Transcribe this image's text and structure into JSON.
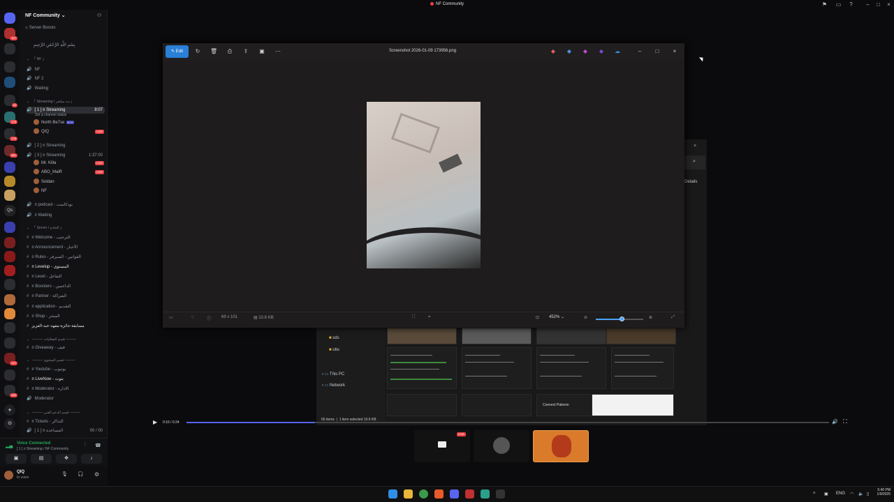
{
  "window": {
    "title": "NF Community"
  },
  "server": {
    "name": "NF Community",
    "boosts": "Server Boosts",
    "intro": "بِسْمِ اللَّهِ الرَّحْمَٰنِ الرَّحِيمِ"
  },
  "rail_badges": [
    "307",
    "178",
    "42",
    "176",
    "561",
    "217",
    "Qs",
    "460"
  ],
  "channels": [
    {
      "label": "「 NF 」",
      "type": "cat"
    },
    {
      "label": "NF",
      "type": "voice"
    },
    {
      "label": "NF 2",
      "type": "voice"
    },
    {
      "label": "Waiting",
      "type": "voice"
    },
    {
      "label": "「 Streaming / بث مباشر 」",
      "type": "cat"
    },
    {
      "label": "[ 1 ] ¤ Streaming",
      "type": "voice",
      "selected": true,
      "right": "8:07"
    },
    {
      "label": "Set a channel status",
      "type": "sub"
    },
    {
      "label": "[ 2 ] ¤ Streaming",
      "type": "voice"
    },
    {
      "label": "[ 3 ] ¤ Streaming",
      "type": "voice",
      "right": "1:37:00"
    },
    {
      "label": "¤ podcast - بودكاست",
      "type": "voice"
    },
    {
      "label": "¤ Waiting",
      "type": "voice"
    },
    {
      "label": "「 Server / الخادم 」",
      "type": "cat"
    },
    {
      "label": "¤ Welcome - الترحيب",
      "type": "text"
    },
    {
      "label": "¤ Announcement - الأخبار",
      "type": "text"
    },
    {
      "label": "¤ Rules - القوانين - السيرفر",
      "type": "text"
    },
    {
      "label": "¤ Levelup - المستوى",
      "type": "text",
      "bright": true
    },
    {
      "label": "¤ Level - التفاعل",
      "type": "text"
    },
    {
      "label": "¤ Boosters - الداعمين",
      "type": "text"
    },
    {
      "label": "¤ Partner - الشراكة",
      "type": "text"
    },
    {
      "label": "¤ application - التقديم",
      "type": "text"
    },
    {
      "label": "¤ Shop - المتجر",
      "type": "text"
    },
    {
      "label": "مسابقة-جائزة-مفهد-عبد-العزيز",
      "type": "text",
      "bright": true
    },
    {
      "label": "——— قسم الفعاليات ———",
      "type": "cat"
    },
    {
      "label": "¤ Giveaway - قيف",
      "type": "text"
    },
    {
      "label": "——— قسم المحتوى ———",
      "type": "cat"
    },
    {
      "label": "¤ Youtube - يوتيوب",
      "type": "text"
    },
    {
      "label": "¤ LiveNow - بثوث",
      "type": "text",
      "bright": true
    },
    {
      "label": "¤ Moderator - الادارة",
      "type": "text"
    },
    {
      "label": "Moderator",
      "type": "voice"
    },
    {
      "label": "——— قسم الدعم الفني ———",
      "type": "cat"
    },
    {
      "label": "¤ Tickets - التذاكر",
      "type": "text"
    },
    {
      "label": "[ 1 ] ¤ المساعدة",
      "type": "voice",
      "right": "00 / 00"
    }
  ],
  "stream_users": [
    {
      "name": "North Be7se",
      "tag": "NTH",
      "live": false
    },
    {
      "name": "QIQ",
      "tag": "",
      "live": true
    },
    {
      "name": "Mr. Killa",
      "tag": "",
      "live": true
    },
    {
      "name": "ABO_MaiR",
      "tag": "",
      "live": true
    },
    {
      "name": "Soldan",
      "tag": "",
      "live": false
    },
    {
      "name": "NF",
      "tag": "",
      "live": false
    }
  ],
  "live_label": "LIVE",
  "voice": {
    "status": "Voice Connected",
    "channel": "[ 1 ] ¤ Streaming / NF Community"
  },
  "me": {
    "name": "QIQ",
    "status": "In voice"
  },
  "viewer": {
    "edit_label": "Edit",
    "filename": "Screenshot 2026-01-09 173956.png",
    "dimensions": "69 x 101",
    "filesize": "10.6 KB",
    "zoom": "452%",
    "zoom_fraction": 0.55
  },
  "explorer": {
    "items_count": "65 items",
    "selected": "1 item selected  10.6 KB",
    "tree": [
      "sds",
      "obs",
      "This PC",
      "Network"
    ],
    "details_label": "Details",
    "thumb_caption": "Connect Patreon"
  },
  "video": {
    "time": "0:16 / 0:24",
    "progress_fraction": 0.2
  },
  "system": {
    "lang": "ENG",
    "time": "5:40 PM",
    "date": "1/9/2026"
  }
}
